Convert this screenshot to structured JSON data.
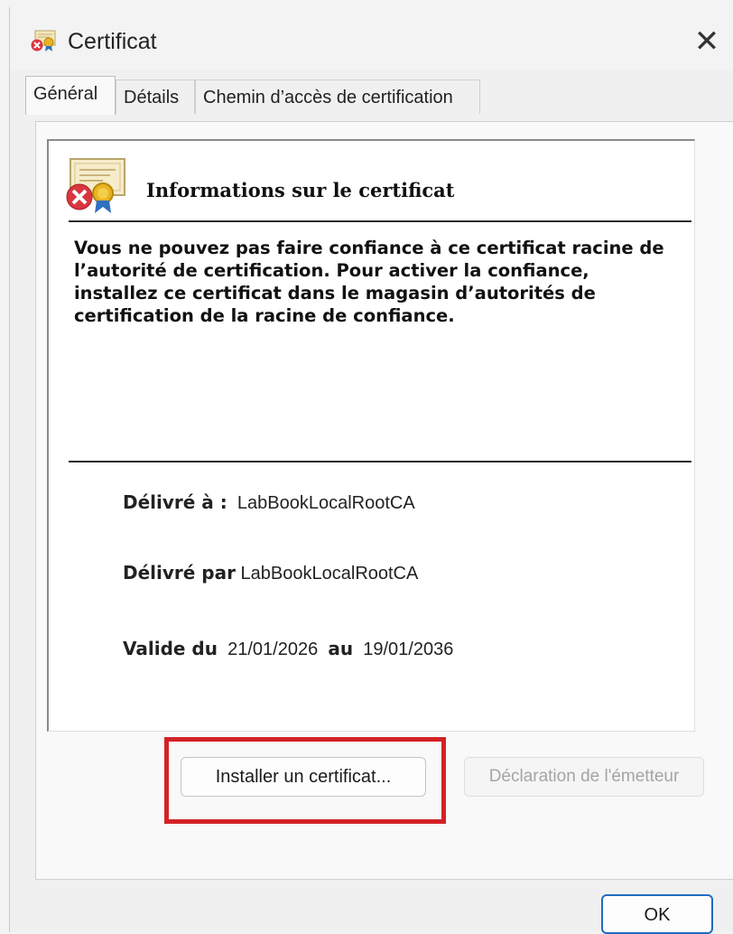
{
  "window": {
    "title": "Certificat",
    "close_symbol": "✕"
  },
  "tabs": [
    {
      "label": "Général",
      "active": true
    },
    {
      "label": "Détails",
      "active": false
    },
    {
      "label": "Chemin d’accès de certification",
      "active": false
    }
  ],
  "info": {
    "heading": "Informations sur le certificat",
    "warning": "Vous ne pouvez pas faire confiance à ce certificat racine de l’autorité de certification. Pour activer la confiance, installez ce certificat dans le magasin d’autorités de certification de la racine de confiance."
  },
  "fields": {
    "issued_to_label": "Délivré à :",
    "issued_to_value": "LabBookLocalRootCA",
    "issued_by_label": "Délivré par",
    "issued_by_value": "LabBookLocalRootCA",
    "valid_from_label": "Valide du",
    "valid_from_value": "21/01/2026",
    "valid_to_label": "au",
    "valid_to_value": "19/01/2036"
  },
  "buttons": {
    "install": "Installer un certificat...",
    "issuer_statement": "Déclaration de l'émetteur",
    "ok": "OK"
  },
  "icons": {
    "title_icon": "certificate-error-icon",
    "info_icon": "certificate-error-icon"
  },
  "colors": {
    "highlight": "#d32127",
    "ok_border": "#1f6cc1",
    "error_red": "#d9363e"
  }
}
